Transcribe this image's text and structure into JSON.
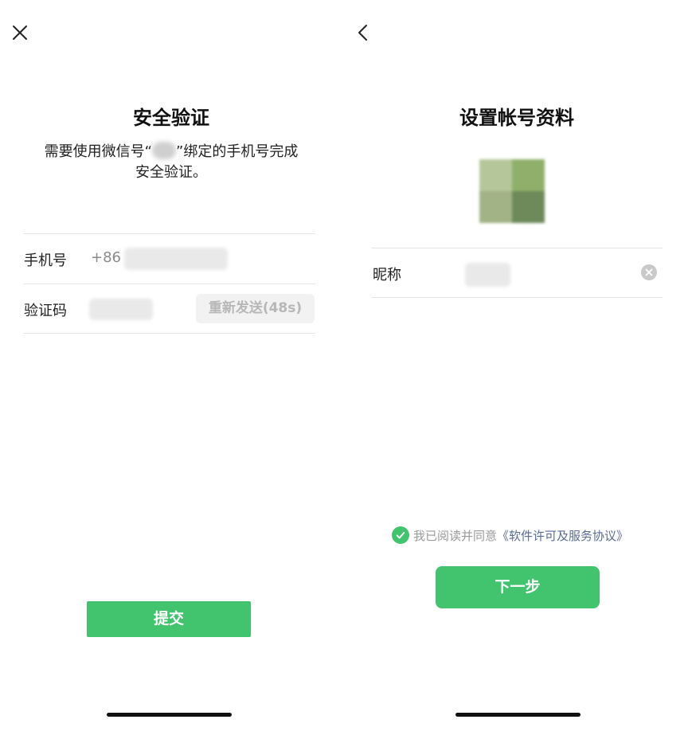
{
  "security": {
    "title": "安全验证",
    "desc_before": "需要使用微信号“",
    "desc_after": "”绑定的手机号完成",
    "desc_line2": "安全验证。",
    "phone_label": "手机号",
    "phone_prefix": "+86",
    "code_label": "验证码",
    "resend_label": "重新发送(48s)",
    "submit_label": "提交",
    "close_icon": "close-icon"
  },
  "profile": {
    "title": "设置帐号资料",
    "nickname_label": "昵称",
    "agree_text": "我已阅读并同意",
    "agree_link": "《软件许可及服务协议》",
    "next_label": "下一步",
    "back_icon": "chevron-left-icon",
    "clear_icon": "clear-icon",
    "check_icon": "check-circle-icon"
  },
  "colors": {
    "accent": "#42c36e",
    "link": "#5a6b96",
    "divider": "#e5e5e5"
  }
}
